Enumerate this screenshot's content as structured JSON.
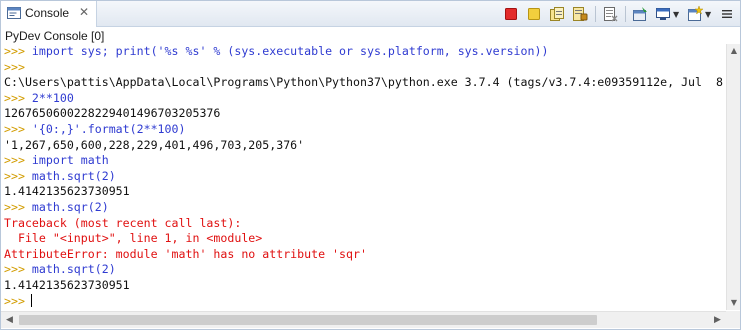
{
  "view_tab": {
    "label": "Console",
    "close_glyph": "✕",
    "icon": "console-icon"
  },
  "toolbar": {
    "icons": [
      "terminate-icon",
      "remove-launch-icon",
      "remove-all-terminated-icon",
      "scroll-lock-icon",
      "clear-console-icon",
      "pin-console-icon",
      "display-selected-console-icon",
      "open-console-icon",
      "view-menu-icon"
    ]
  },
  "console_title": "PyDev Console [0]",
  "colors": {
    "prompt": "#d29c00",
    "input": "#2f3bd1",
    "output": "#111111",
    "error": "#e01010"
  },
  "lines": [
    {
      "kind": "input",
      "prompt": ">>> ",
      "text": "import sys; print('%s %s' % (sys.executable or sys.platform, sys.version))"
    },
    {
      "kind": "input",
      "prompt": ">>> ",
      "text": ""
    },
    {
      "kind": "output",
      "text": "C:\\Users\\pattis\\AppData\\Local\\Programs\\Python\\Python37\\python.exe 3.7.4 (tags/v3.7.4:e09359112e, Jul  8"
    },
    {
      "kind": "input",
      "prompt": ">>> ",
      "text": "2**100"
    },
    {
      "kind": "output",
      "text": "1267650600228229401496703205376"
    },
    {
      "kind": "input",
      "prompt": ">>> ",
      "text": "'{0:,}'.format(2**100)"
    },
    {
      "kind": "output",
      "text": "'1,267,650,600,228,229,401,496,703,205,376'"
    },
    {
      "kind": "input",
      "prompt": ">>> ",
      "text": "import math"
    },
    {
      "kind": "input",
      "prompt": ">>> ",
      "text": "math.sqrt(2)"
    },
    {
      "kind": "output",
      "text": "1.4142135623730951"
    },
    {
      "kind": "input",
      "prompt": ">>> ",
      "text": "math.sqr(2)"
    },
    {
      "kind": "error",
      "text": "Traceback (most recent call last):"
    },
    {
      "kind": "error",
      "text": "  File \"<input>\", line 1, in <module>"
    },
    {
      "kind": "error",
      "text": "AttributeError: module 'math' has no attribute 'sqr'"
    },
    {
      "kind": "input",
      "prompt": ">>> ",
      "text": "math.sqrt(2)"
    },
    {
      "kind": "output",
      "text": "1.4142135623730951"
    },
    {
      "kind": "cursor",
      "prompt": ">>> ",
      "text": ""
    }
  ]
}
